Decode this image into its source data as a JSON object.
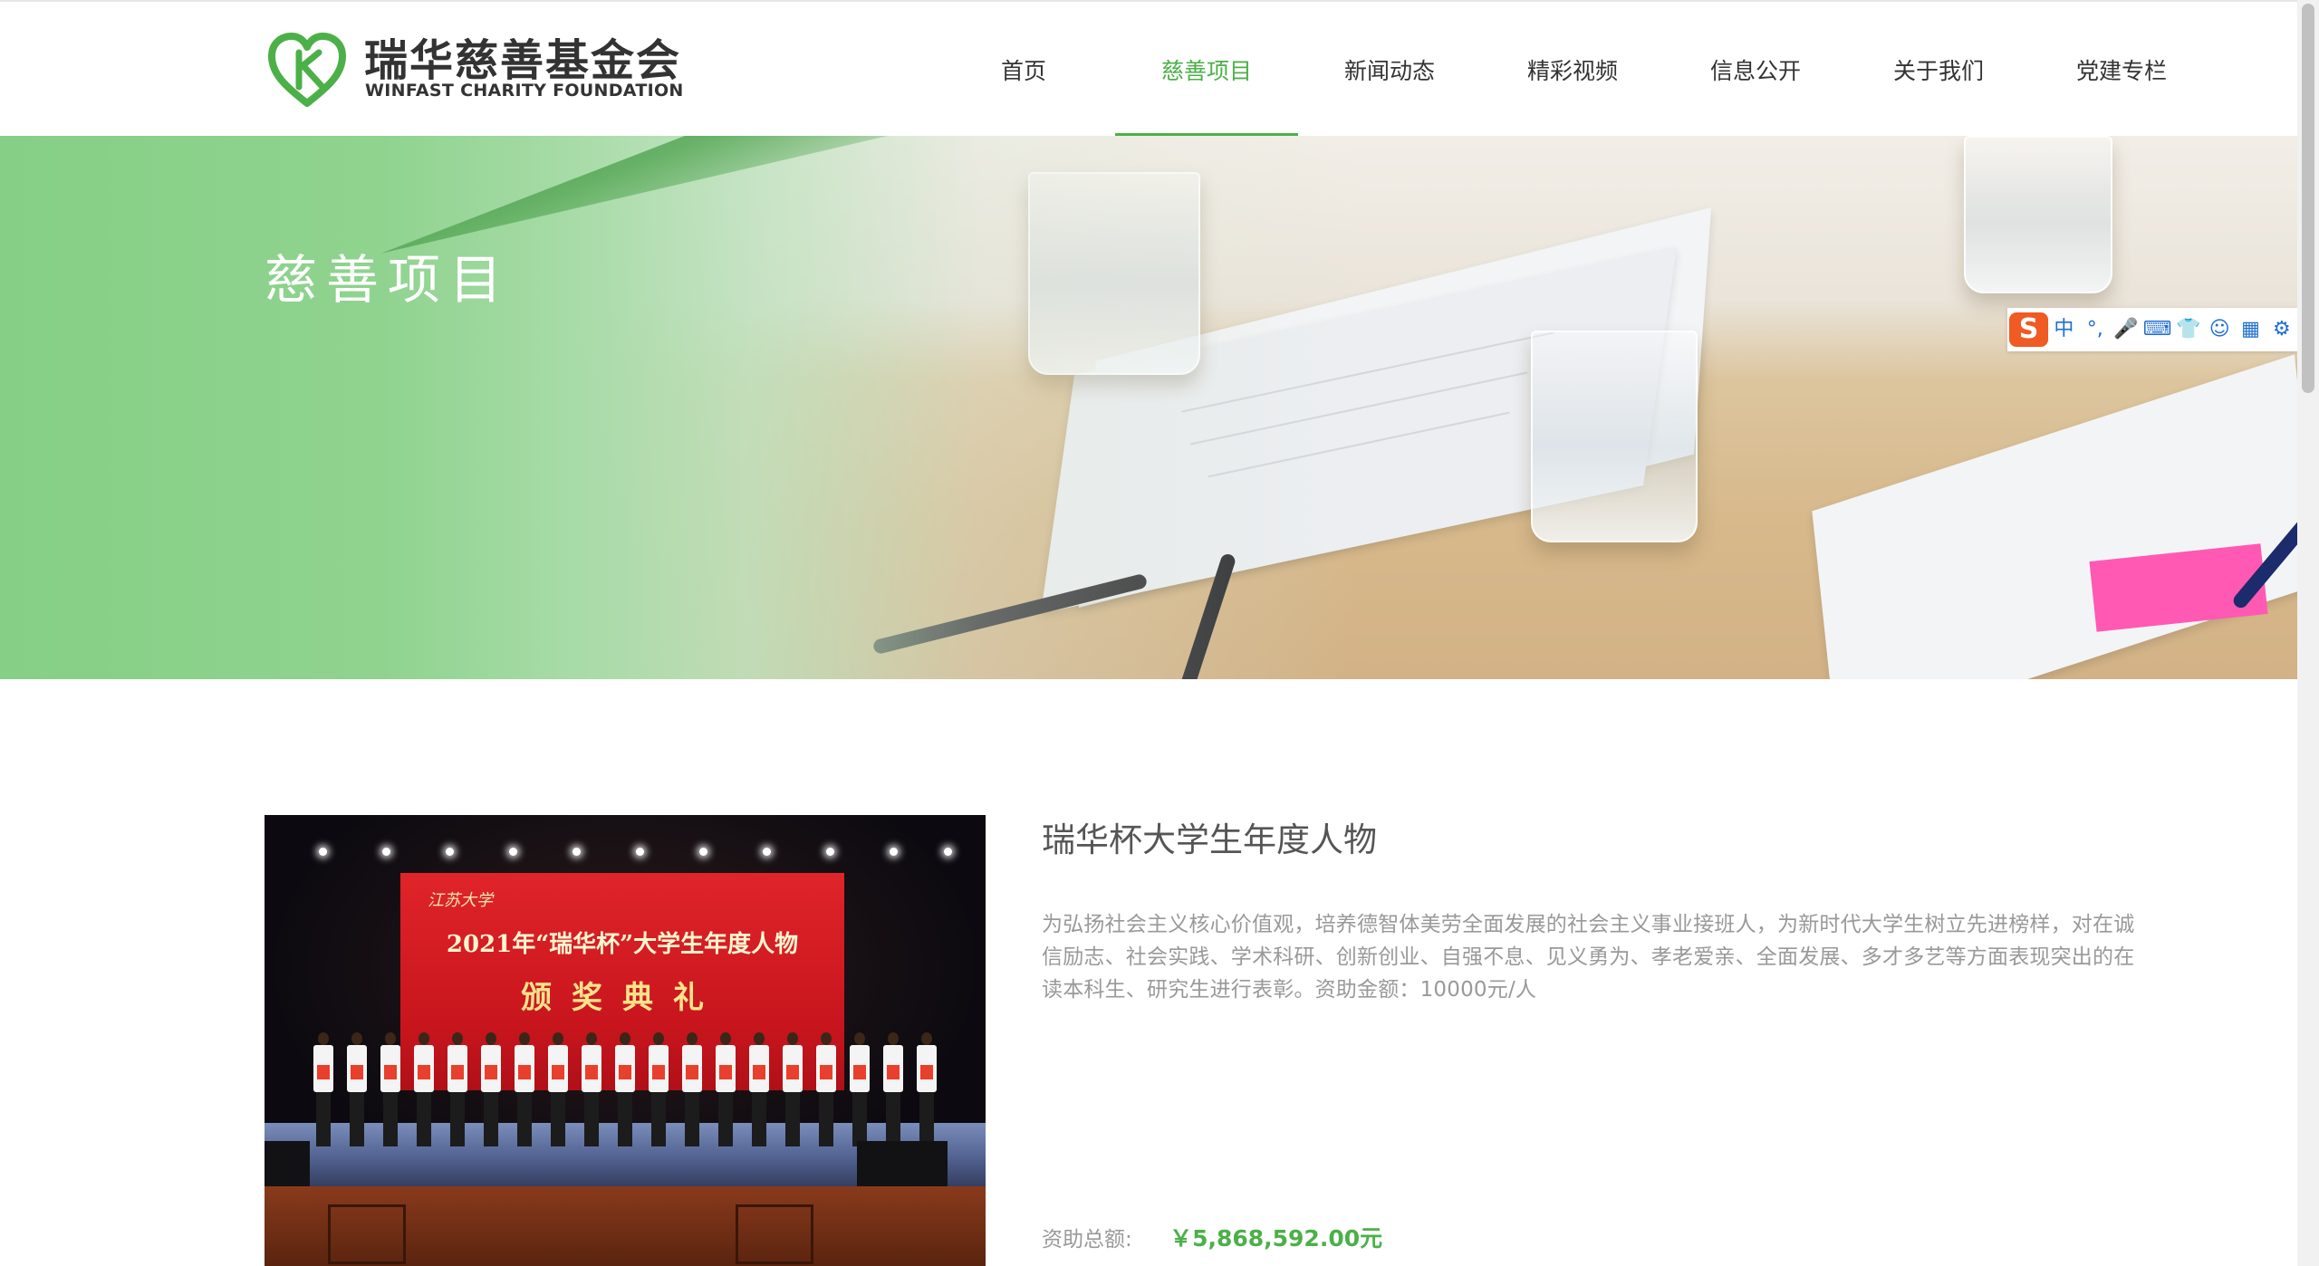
{
  "brand": {
    "name_cn": "瑞华慈善基金会",
    "name_en": "WINFAST CHARITY FOUNDATION"
  },
  "nav": {
    "items": [
      {
        "label": "首页",
        "active": false
      },
      {
        "label": "慈善项目",
        "active": true
      },
      {
        "label": "新闻动态",
        "active": false
      },
      {
        "label": "精彩视频",
        "active": false
      },
      {
        "label": "信息公开",
        "active": false
      },
      {
        "label": "关于我们",
        "active": false
      },
      {
        "label": "党建专栏",
        "active": false
      }
    ]
  },
  "banner": {
    "title": "慈善项目"
  },
  "ime_toolbar": {
    "logo": "S",
    "items": [
      "中",
      "°,",
      "mic-icon",
      "keyboard-icon",
      "skin-icon",
      "emoji-icon",
      "apps-icon",
      "settings-icon"
    ],
    "items_display": [
      "中",
      "°,",
      "🎤",
      "⌨",
      "👕",
      "☺",
      "▦",
      "⚙"
    ]
  },
  "project": {
    "title": "瑞华杯大学生年度人物",
    "description": "为弘扬社会主义核心价值观，培养德智体美劳全面发展的社会主义事业接班人，为新时代大学生树立先进榜样，对在诚信励志、社会实践、学术科研、创新创业、自强不息、见义勇为、孝老爱亲、全面发展、多才多艺等方面表现突出的在读本科生、研究生进行表彰。资助金额：10000元/人",
    "funding_label": "资助总额:",
    "funding_value": "￥5,868,592.00元",
    "image": {
      "screen_top": "江苏大学",
      "screen_line1": "2021年“瑞华杯”大学生年度人物",
      "screen_line2": "颁奖典礼"
    }
  },
  "colors": {
    "accent": "#4cb048",
    "text": "#333333",
    "muted": "#999999"
  }
}
